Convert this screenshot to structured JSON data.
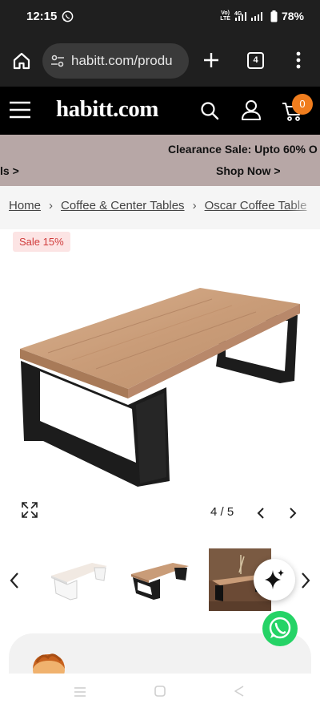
{
  "status_bar": {
    "time": "12:15",
    "volte_top": "Vo)",
    "volte_bottom": "LTE",
    "network": "4G",
    "battery": "78%"
  },
  "browser": {
    "url": "habitt.com/produ",
    "tab_count": "4"
  },
  "site": {
    "logo": "habitt.com",
    "cart_count": "0"
  },
  "promo": {
    "line1": "Clearance Sale: Upto 60% O",
    "line2_left": "ls >",
    "line2_cta": "Shop Now >"
  },
  "breadcrumb": {
    "items": [
      "Home",
      "Coffee & Center Tables",
      "Oscar Coffee Table"
    ]
  },
  "product": {
    "sale_badge": "Sale 15%",
    "image_counter": "4 / 5"
  },
  "icons": {
    "status": [
      "whatsapp-status-icon",
      "signal-icon",
      "battery-icon"
    ],
    "browser": [
      "home-icon",
      "tune-icon",
      "plus-icon",
      "tabs-icon",
      "more-icon"
    ],
    "site": [
      "hamburger-icon",
      "search-icon",
      "user-icon",
      "cart-icon"
    ],
    "gallery": [
      "expand-icon",
      "chevron-left-icon",
      "chevron-right-icon",
      "sparkle-icon",
      "whatsapp-icon"
    ]
  },
  "colors": {
    "top_bars": "#1f1f1f",
    "header": "#000000",
    "promo_band": "#b7a7a6",
    "cart_badge": "#f07d1e",
    "sale_badge_bg": "#fce4e4",
    "sale_badge_text": "#d03b3b",
    "whatsapp": "#25d366"
  }
}
